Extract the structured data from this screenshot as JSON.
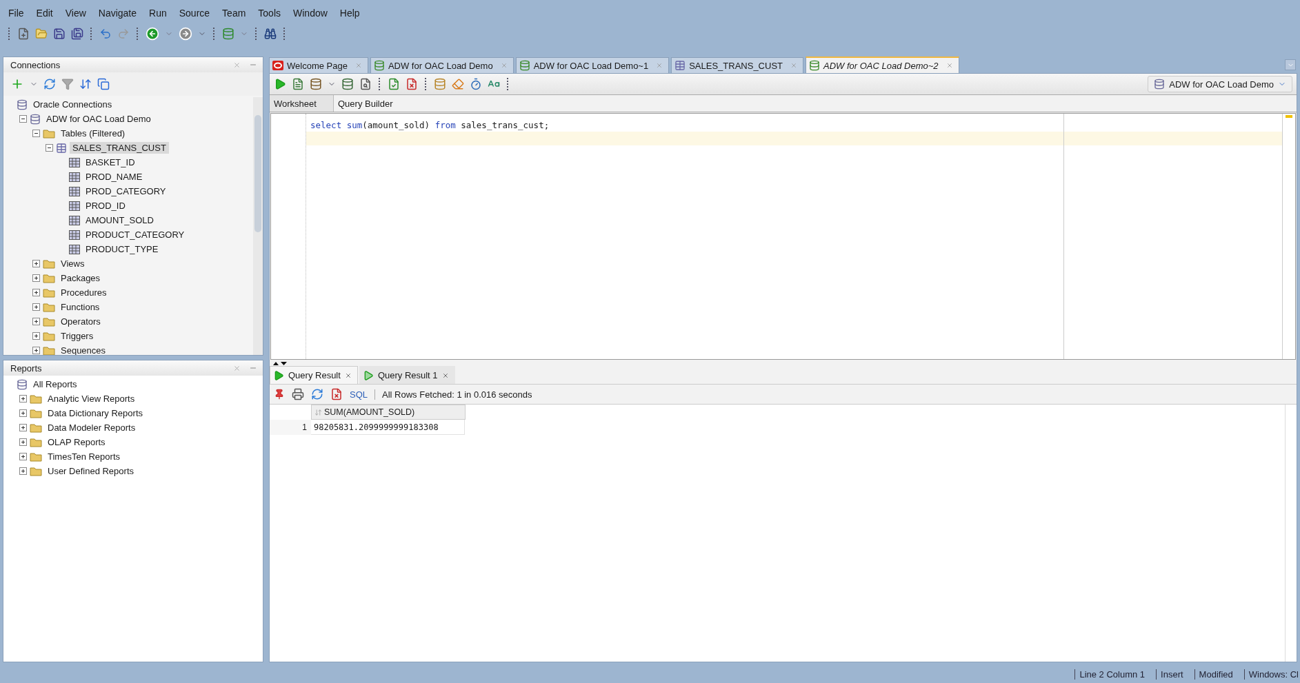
{
  "menu": [
    {
      "label": "File"
    },
    {
      "label": "Edit"
    },
    {
      "label": "View"
    },
    {
      "label": "Navigate"
    },
    {
      "label": "Run"
    },
    {
      "label": "Source"
    },
    {
      "label": "Team"
    },
    {
      "label": "Tools"
    },
    {
      "label": "Window"
    },
    {
      "label": "Help"
    }
  ],
  "connections": {
    "title": "Connections",
    "tree": [
      {
        "label": "Oracle Connections",
        "kind": "root",
        "selected": false,
        "children": [
          {
            "label": "ADW for OAC Load Demo",
            "kind": "connection",
            "expanded": true,
            "selected": false,
            "children": [
              {
                "label": "Tables (Filtered)",
                "kind": "folder",
                "expanded": true,
                "selected": false,
                "children": [
                  {
                    "label": "SALES_TRANS_CUST",
                    "kind": "table",
                    "expanded": true,
                    "selected": true,
                    "children": [
                      {
                        "label": "BASKET_ID",
                        "kind": "column",
                        "selected": false
                      },
                      {
                        "label": "PROD_NAME",
                        "kind": "column",
                        "selected": false
                      },
                      {
                        "label": "PROD_CATEGORY",
                        "kind": "column",
                        "selected": false
                      },
                      {
                        "label": "PROD_ID",
                        "kind": "column",
                        "selected": false
                      },
                      {
                        "label": "AMOUNT_SOLD",
                        "kind": "column",
                        "selected": false
                      },
                      {
                        "label": "PRODUCT_CATEGORY",
                        "kind": "column",
                        "selected": false
                      },
                      {
                        "label": "PRODUCT_TYPE",
                        "kind": "column",
                        "selected": false
                      }
                    ]
                  }
                ]
              },
              {
                "label": "Views",
                "kind": "folder",
                "expanded": false,
                "selected": false
              },
              {
                "label": "Packages",
                "kind": "folder",
                "expanded": false,
                "selected": false
              },
              {
                "label": "Procedures",
                "kind": "folder",
                "expanded": false,
                "selected": false
              },
              {
                "label": "Functions",
                "kind": "folder",
                "expanded": false,
                "selected": false
              },
              {
                "label": "Operators",
                "kind": "folder",
                "expanded": false,
                "selected": false
              },
              {
                "label": "Triggers",
                "kind": "folder",
                "expanded": false,
                "selected": false
              },
              {
                "label": "Sequences",
                "kind": "folder",
                "expanded": false,
                "selected": false
              }
            ]
          }
        ]
      }
    ]
  },
  "reports": {
    "title": "Reports",
    "tree": [
      {
        "label": "All Reports",
        "kind": "root",
        "selected": false,
        "children": [
          {
            "label": "Analytic View Reports",
            "kind": "folder",
            "expanded": false,
            "selected": false
          },
          {
            "label": "Data Dictionary Reports",
            "kind": "folder",
            "expanded": false,
            "selected": false
          },
          {
            "label": "Data Modeler Reports",
            "kind": "folder",
            "expanded": false,
            "selected": false
          },
          {
            "label": "OLAP Reports",
            "kind": "folder",
            "expanded": false,
            "selected": false
          },
          {
            "label": "TimesTen Reports",
            "kind": "folder",
            "expanded": false,
            "selected": false
          },
          {
            "label": "User Defined Reports",
            "kind": "folder",
            "expanded": false,
            "selected": false
          }
        ]
      }
    ]
  },
  "editor_tabs": [
    {
      "label": "Welcome Page",
      "kind": "welcome",
      "selected": false
    },
    {
      "label": "ADW for OAC Load Demo",
      "kind": "sql",
      "selected": false
    },
    {
      "label": "ADW for OAC Load Demo~1",
      "kind": "sql",
      "selected": false
    },
    {
      "label": "SALES_TRANS_CUST",
      "kind": "table",
      "selected": false
    },
    {
      "label": "ADW for OAC Load Demo~2",
      "kind": "sql",
      "selected": true
    }
  ],
  "connection_selector": "ADW for OAC Load Demo",
  "worksheet_tabs": [
    {
      "label": "Worksheet",
      "selected": true
    },
    {
      "label": "Query Builder",
      "selected": false
    }
  ],
  "editor": {
    "lines": [
      {
        "current": false,
        "tokens": [
          {
            "text": "select ",
            "kind": "keyword"
          },
          {
            "text": "sum",
            "kind": "function"
          },
          {
            "text": "(amount_sold) ",
            "kind": "plain"
          },
          {
            "text": "from",
            "kind": "keyword"
          },
          {
            "text": " sales_trans_cust;",
            "kind": "plain"
          }
        ]
      },
      {
        "current": true
      }
    ]
  },
  "result_tabs": [
    {
      "label": "Query Result",
      "selected": true
    },
    {
      "label": "Query Result 1",
      "selected": false
    }
  ],
  "result_toolbar": {
    "sql_link": "SQL",
    "status": "All Rows Fetched: 1 in 0.016 seconds"
  },
  "grid": {
    "columns": [
      "SUM(AMOUNT_SOLD)"
    ],
    "rows": [
      {
        "number": "1",
        "cells": [
          "98205831.2099999999183308"
        ]
      }
    ]
  },
  "status_bar": [
    "Line 2 Column 1",
    "Insert",
    "Modified",
    "Windows: Cl"
  ]
}
